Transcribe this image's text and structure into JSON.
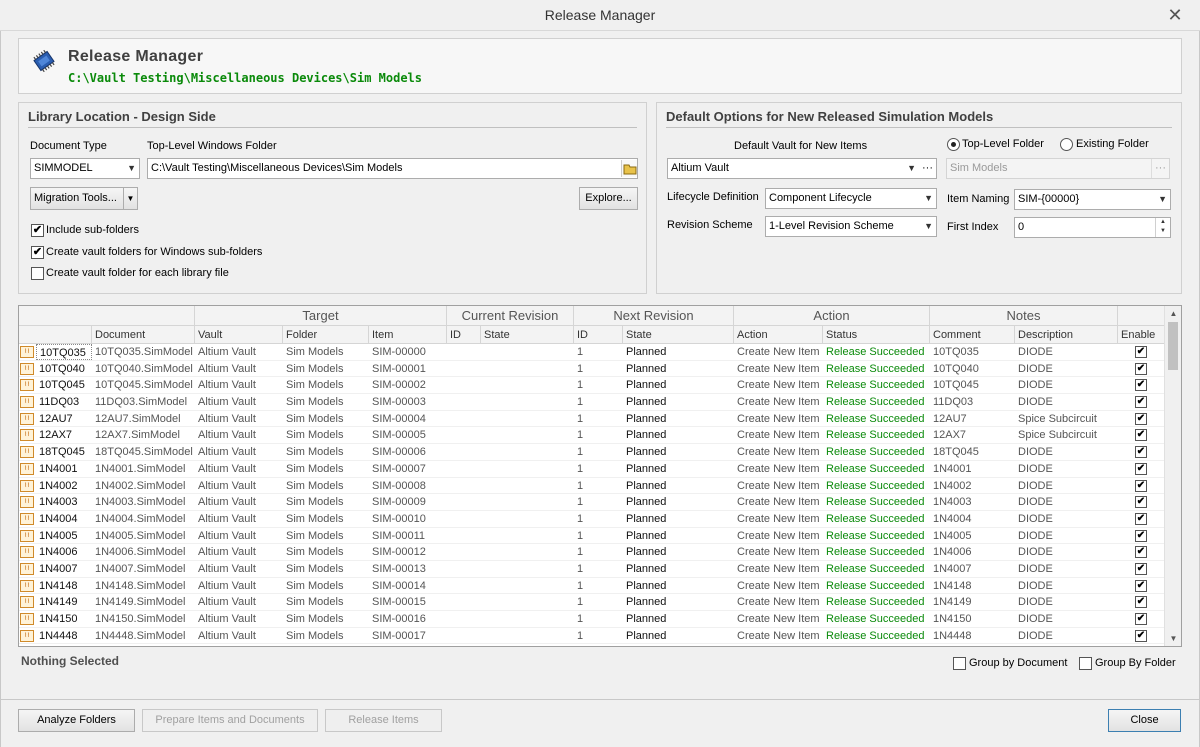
{
  "window": {
    "title": "Release Manager",
    "close_glyph": "✕"
  },
  "header": {
    "title": "Release Manager",
    "path": "C:\\Vault Testing\\Miscellaneous Devices\\Sim Models",
    "icon": "chip-icon"
  },
  "library_location": {
    "title": "Library Location - Design Side",
    "document_type_label": "Document Type",
    "document_type_value": "SIMMODEL",
    "top_folder_label": "Top-Level Windows Folder",
    "top_folder_value": "C:\\Vault Testing\\Miscellaneous Devices\\Sim Models",
    "migration_tools_label": "Migration Tools...",
    "explore_label": "Explore...",
    "include_subfolders_label": "Include sub-folders",
    "include_subfolders_checked": true,
    "create_vault_folders_label": "Create vault folders for Windows sub-folders",
    "create_vault_folders_checked": true,
    "create_folder_each_label": "Create vault folder for each library file",
    "create_folder_each_checked": false
  },
  "defaults": {
    "title": "Default Options for New Released Simulation Models",
    "default_vault_label": "Default Vault for New Items",
    "default_vault_value": "Altium Vault",
    "top_level_folder_label": "Top-Level Folder",
    "existing_folder_label": "Existing Folder",
    "folder_value": "Sim Models",
    "lifecycle_label": "Lifecycle Definition",
    "lifecycle_value": "Component Lifecycle",
    "item_naming_label": "Item Naming",
    "item_naming_value": "SIM-{00000}",
    "revision_scheme_label": "Revision Scheme",
    "revision_scheme_value": "1-Level Revision Scheme",
    "first_index_label": "First Index",
    "first_index_value": "0"
  },
  "grid": {
    "groups": [
      "Target",
      "Current Revision",
      "Next Revision",
      "Action",
      "Notes"
    ],
    "columns": [
      "Document",
      "Vault",
      "Folder",
      "Item",
      "ID",
      "State",
      "ID",
      "State",
      "Action",
      "Status",
      "Comment",
      "Description",
      "Enable"
    ],
    "rows": [
      {
        "name": "10TQ035",
        "doc": "10TQ035.SimModel",
        "vault": "Altium Vault",
        "folder": "Sim Models",
        "item": "SIM-00000",
        "next_id": "1",
        "next_state": "Planned",
        "action": "Create New Item",
        "status": "Release Succeeded",
        "comment": "10TQ035",
        "description": "DIODE"
      },
      {
        "name": "10TQ040",
        "doc": "10TQ040.SimModel",
        "vault": "Altium Vault",
        "folder": "Sim Models",
        "item": "SIM-00001",
        "next_id": "1",
        "next_state": "Planned",
        "action": "Create New Item",
        "status": "Release Succeeded",
        "comment": "10TQ040",
        "description": "DIODE"
      },
      {
        "name": "10TQ045",
        "doc": "10TQ045.SimModel",
        "vault": "Altium Vault",
        "folder": "Sim Models",
        "item": "SIM-00002",
        "next_id": "1",
        "next_state": "Planned",
        "action": "Create New Item",
        "status": "Release Succeeded",
        "comment": "10TQ045",
        "description": "DIODE"
      },
      {
        "name": "11DQ03",
        "doc": "11DQ03.SimModel",
        "vault": "Altium Vault",
        "folder": "Sim Models",
        "item": "SIM-00003",
        "next_id": "1",
        "next_state": "Planned",
        "action": "Create New Item",
        "status": "Release Succeeded",
        "comment": "11DQ03",
        "description": "DIODE"
      },
      {
        "name": "12AU7",
        "doc": "12AU7.SimModel",
        "vault": "Altium Vault",
        "folder": "Sim Models",
        "item": "SIM-00004",
        "next_id": "1",
        "next_state": "Planned",
        "action": "Create New Item",
        "status": "Release Succeeded",
        "comment": "12AU7",
        "description": "Spice Subcircuit"
      },
      {
        "name": "12AX7",
        "doc": "12AX7.SimModel",
        "vault": "Altium Vault",
        "folder": "Sim Models",
        "item": "SIM-00005",
        "next_id": "1",
        "next_state": "Planned",
        "action": "Create New Item",
        "status": "Release Succeeded",
        "comment": "12AX7",
        "description": "Spice Subcircuit"
      },
      {
        "name": "18TQ045",
        "doc": "18TQ045.SimModel",
        "vault": "Altium Vault",
        "folder": "Sim Models",
        "item": "SIM-00006",
        "next_id": "1",
        "next_state": "Planned",
        "action": "Create New Item",
        "status": "Release Succeeded",
        "comment": "18TQ045",
        "description": "DIODE"
      },
      {
        "name": "1N4001",
        "doc": "1N4001.SimModel",
        "vault": "Altium Vault",
        "folder": "Sim Models",
        "item": "SIM-00007",
        "next_id": "1",
        "next_state": "Planned",
        "action": "Create New Item",
        "status": "Release Succeeded",
        "comment": "1N4001",
        "description": "DIODE"
      },
      {
        "name": "1N4002",
        "doc": "1N4002.SimModel",
        "vault": "Altium Vault",
        "folder": "Sim Models",
        "item": "SIM-00008",
        "next_id": "1",
        "next_state": "Planned",
        "action": "Create New Item",
        "status": "Release Succeeded",
        "comment": "1N4002",
        "description": "DIODE"
      },
      {
        "name": "1N4003",
        "doc": "1N4003.SimModel",
        "vault": "Altium Vault",
        "folder": "Sim Models",
        "item": "SIM-00009",
        "next_id": "1",
        "next_state": "Planned",
        "action": "Create New Item",
        "status": "Release Succeeded",
        "comment": "1N4003",
        "description": "DIODE"
      },
      {
        "name": "1N4004",
        "doc": "1N4004.SimModel",
        "vault": "Altium Vault",
        "folder": "Sim Models",
        "item": "SIM-00010",
        "next_id": "1",
        "next_state": "Planned",
        "action": "Create New Item",
        "status": "Release Succeeded",
        "comment": "1N4004",
        "description": "DIODE"
      },
      {
        "name": "1N4005",
        "doc": "1N4005.SimModel",
        "vault": "Altium Vault",
        "folder": "Sim Models",
        "item": "SIM-00011",
        "next_id": "1",
        "next_state": "Planned",
        "action": "Create New Item",
        "status": "Release Succeeded",
        "comment": "1N4005",
        "description": "DIODE"
      },
      {
        "name": "1N4006",
        "doc": "1N4006.SimModel",
        "vault": "Altium Vault",
        "folder": "Sim Models",
        "item": "SIM-00012",
        "next_id": "1",
        "next_state": "Planned",
        "action": "Create New Item",
        "status": "Release Succeeded",
        "comment": "1N4006",
        "description": "DIODE"
      },
      {
        "name": "1N4007",
        "doc": "1N4007.SimModel",
        "vault": "Altium Vault",
        "folder": "Sim Models",
        "item": "SIM-00013",
        "next_id": "1",
        "next_state": "Planned",
        "action": "Create New Item",
        "status": "Release Succeeded",
        "comment": "1N4007",
        "description": "DIODE"
      },
      {
        "name": "1N4148",
        "doc": "1N4148.SimModel",
        "vault": "Altium Vault",
        "folder": "Sim Models",
        "item": "SIM-00014",
        "next_id": "1",
        "next_state": "Planned",
        "action": "Create New Item",
        "status": "Release Succeeded",
        "comment": "1N4148",
        "description": "DIODE"
      },
      {
        "name": "1N4149",
        "doc": "1N4149.SimModel",
        "vault": "Altium Vault",
        "folder": "Sim Models",
        "item": "SIM-00015",
        "next_id": "1",
        "next_state": "Planned",
        "action": "Create New Item",
        "status": "Release Succeeded",
        "comment": "1N4149",
        "description": "DIODE"
      },
      {
        "name": "1N4150",
        "doc": "1N4150.SimModel",
        "vault": "Altium Vault",
        "folder": "Sim Models",
        "item": "SIM-00016",
        "next_id": "1",
        "next_state": "Planned",
        "action": "Create New Item",
        "status": "Release Succeeded",
        "comment": "1N4150",
        "description": "DIODE"
      },
      {
        "name": "1N4448",
        "doc": "1N4448.SimModel",
        "vault": "Altium Vault",
        "folder": "Sim Models",
        "item": "SIM-00017",
        "next_id": "1",
        "next_state": "Planned",
        "action": "Create New Item",
        "status": "Release Succeeded",
        "comment": "1N4448",
        "description": "DIODE"
      }
    ],
    "row_enabled": true
  },
  "status_text": "Nothing Selected",
  "group_by_document_label": "Group by Document",
  "group_by_folder_label": "Group By Folder",
  "buttons": {
    "analyze": "Analyze Folders",
    "prepare": "Prepare Items and Documents",
    "release": "Release Items",
    "close": "Close"
  }
}
